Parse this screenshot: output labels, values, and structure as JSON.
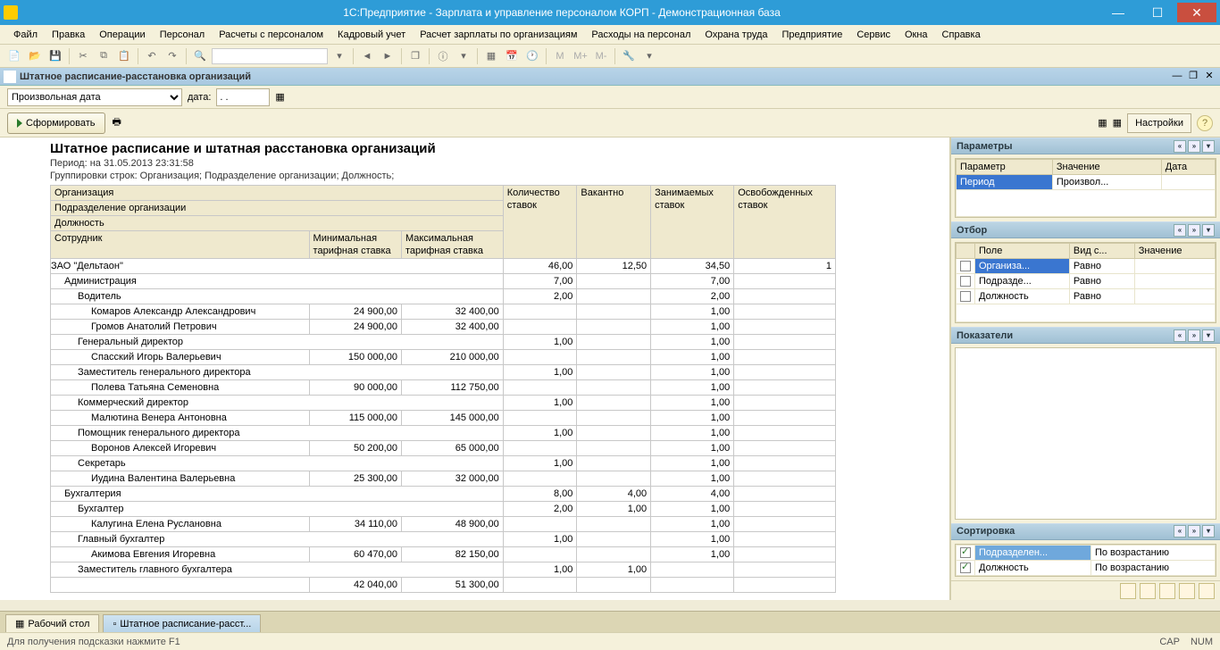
{
  "window": {
    "title": "1С:Предприятие - Зарплата и управление персоналом КОРП - Демонстрационная база"
  },
  "menu": [
    "Файл",
    "Правка",
    "Операции",
    "Персонал",
    "Расчеты с персоналом",
    "Кадровый учет",
    "Расчет зарплаты по организациям",
    "Расходы на персонал",
    "Охрана труда",
    "Предприятие",
    "Сервис",
    "Окна",
    "Справка"
  ],
  "doc": {
    "title": "Штатное расписание-расстановка организаций"
  },
  "filter": {
    "mode": "Произвольная дата",
    "date_label": "дата:",
    "date_value": ". ."
  },
  "action": {
    "form": "Сформировать",
    "settings": "Настройки"
  },
  "report": {
    "title": "Штатное расписание и штатная расстановка организаций",
    "period": "Период: на 31.05.2013 23:31:58",
    "grouping": "Группировки строк: Организация; Подразделение организации; Должность;",
    "headers": {
      "org": "Организация",
      "dept": "Подразделение организации",
      "pos": "Должность",
      "emp": "Сотрудник",
      "min": "Минимальная тарифная ставка",
      "max": "Максимальная тарифная ставка",
      "qty": "Количество ставок",
      "vac": "Вакантно",
      "occ": "Занимаемых ставок",
      "rel": "Освобожденных ставок"
    },
    "rows": [
      {
        "lvl": 0,
        "name": "ЗАО \"Дельтаон\"",
        "qty": "46,00",
        "vac": "12,50",
        "occ": "34,50",
        "rel": "1"
      },
      {
        "lvl": 1,
        "name": "Администрация",
        "qty": "7,00",
        "vac": "",
        "occ": "7,00",
        "rel": ""
      },
      {
        "lvl": 2,
        "name": "Водитель",
        "qty": "2,00",
        "vac": "",
        "occ": "2,00",
        "rel": ""
      },
      {
        "lvl": 3,
        "name": "Комаров Александр Александрович",
        "min": "24 900,00",
        "max": "32 400,00",
        "qty": "",
        "vac": "",
        "occ": "1,00",
        "rel": ""
      },
      {
        "lvl": 3,
        "name": "Громов Анатолий Петрович",
        "min": "24 900,00",
        "max": "32 400,00",
        "qty": "",
        "vac": "",
        "occ": "1,00",
        "rel": ""
      },
      {
        "lvl": 2,
        "name": "Генеральный директор",
        "qty": "1,00",
        "vac": "",
        "occ": "1,00",
        "rel": ""
      },
      {
        "lvl": 3,
        "name": "Спасский Игорь Валерьевич",
        "min": "150 000,00",
        "max": "210 000,00",
        "qty": "",
        "vac": "",
        "occ": "1,00",
        "rel": ""
      },
      {
        "lvl": 2,
        "name": "Заместитель генерального директора",
        "qty": "1,00",
        "vac": "",
        "occ": "1,00",
        "rel": ""
      },
      {
        "lvl": 3,
        "name": "Полева Татьяна Семеновна",
        "min": "90 000,00",
        "max": "112 750,00",
        "qty": "",
        "vac": "",
        "occ": "1,00",
        "rel": ""
      },
      {
        "lvl": 2,
        "name": "Коммерческий директор",
        "qty": "1,00",
        "vac": "",
        "occ": "1,00",
        "rel": ""
      },
      {
        "lvl": 3,
        "name": "Малютина Венера Антоновна",
        "min": "115 000,00",
        "max": "145 000,00",
        "qty": "",
        "vac": "",
        "occ": "1,00",
        "rel": ""
      },
      {
        "lvl": 2,
        "name": "Помощник генерального директора",
        "qty": "1,00",
        "vac": "",
        "occ": "1,00",
        "rel": ""
      },
      {
        "lvl": 3,
        "name": "Воронов Алексей Игоревич",
        "min": "50 200,00",
        "max": "65 000,00",
        "qty": "",
        "vac": "",
        "occ": "1,00",
        "rel": ""
      },
      {
        "lvl": 2,
        "name": "Секретарь",
        "qty": "1,00",
        "vac": "",
        "occ": "1,00",
        "rel": ""
      },
      {
        "lvl": 3,
        "name": "Иудина Валентина Валерьевна",
        "min": "25 300,00",
        "max": "32 000,00",
        "qty": "",
        "vac": "",
        "occ": "1,00",
        "rel": ""
      },
      {
        "lvl": 1,
        "name": "Бухгалтерия",
        "qty": "8,00",
        "vac": "4,00",
        "occ": "4,00",
        "rel": ""
      },
      {
        "lvl": 2,
        "name": "Бухгалтер",
        "qty": "2,00",
        "vac": "1,00",
        "occ": "1,00",
        "rel": ""
      },
      {
        "lvl": 3,
        "name": "Калугина Елена Руслановна",
        "min": "34 110,00",
        "max": "48 900,00",
        "qty": "",
        "vac": "",
        "occ": "1,00",
        "rel": ""
      },
      {
        "lvl": 2,
        "name": "Главный бухгалтер",
        "qty": "1,00",
        "vac": "",
        "occ": "1,00",
        "rel": ""
      },
      {
        "lvl": 3,
        "name": "Акимова Евгения Игоревна",
        "min": "60 470,00",
        "max": "82 150,00",
        "qty": "",
        "vac": "",
        "occ": "1,00",
        "rel": ""
      },
      {
        "lvl": 2,
        "name": "Заместитель главного бухгалтера",
        "qty": "1,00",
        "vac": "1,00",
        "occ": "",
        "rel": ""
      },
      {
        "lvl": 3,
        "name": "",
        "min": "42 040,00",
        "max": "51 300,00",
        "qty": "",
        "vac": "",
        "occ": "",
        "rel": ""
      }
    ]
  },
  "panels": {
    "params": {
      "title": "Параметры",
      "cols": [
        "Параметр",
        "Значение",
        "Дата"
      ],
      "rows": [
        {
          "p": "Период",
          "v": "Произвол...",
          "d": ""
        }
      ]
    },
    "filter": {
      "title": "Отбор",
      "cols": [
        "Поле",
        "Вид с...",
        "Значение"
      ],
      "rows": [
        {
          "f": "Организа...",
          "c": "Равно",
          "v": ""
        },
        {
          "f": "Подразде...",
          "c": "Равно",
          "v": ""
        },
        {
          "f": "Должность",
          "c": "Равно",
          "v": ""
        }
      ]
    },
    "indicators": {
      "title": "Показатели"
    },
    "sort": {
      "title": "Сортировка",
      "rows": [
        {
          "f": "Подразделен...",
          "d": "По возрастанию"
        },
        {
          "f": "Должность",
          "d": "По возрастанию"
        }
      ]
    }
  },
  "tabs": {
    "desktop": "Рабочий стол",
    "doc": "Штатное расписание-расст..."
  },
  "status": {
    "hint": "Для получения подсказки нажмите F1",
    "cap": "CAP",
    "num": "NUM"
  }
}
